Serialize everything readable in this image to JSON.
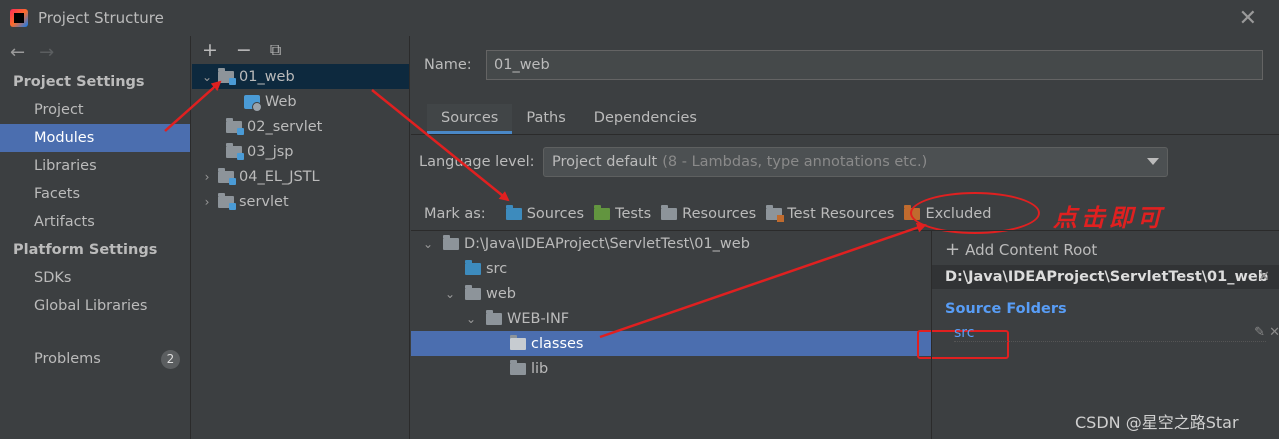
{
  "window": {
    "title": "Project Structure",
    "close_icon": "close-icon"
  },
  "nav": {
    "project_settings": "Project Settings",
    "project_items": [
      "Project",
      "Modules",
      "Libraries",
      "Facets",
      "Artifacts"
    ],
    "platform_settings": "Platform Settings",
    "platform_items": [
      "SDKs",
      "Global Libraries"
    ],
    "problems": "Problems",
    "problems_count": "2",
    "active": "Modules"
  },
  "modules_tree": {
    "tools": {
      "add": "+",
      "remove": "−",
      "copy": "⧉"
    },
    "items": [
      {
        "label": "01_web",
        "expanded": true,
        "selected": true
      },
      {
        "label": "Web"
      },
      {
        "label": "02_servlet"
      },
      {
        "label": "03_jsp"
      },
      {
        "label": "04_EL_JSTL"
      },
      {
        "label": "servlet"
      }
    ]
  },
  "content": {
    "name_label": "Name:",
    "name_value": "01_web",
    "tabs": [
      "Sources",
      "Paths",
      "Dependencies"
    ],
    "active_tab": "Sources",
    "language_label": "Language level:",
    "language_value": "Project default",
    "language_hint": "(8 - Lambdas, type annotations etc.)",
    "mark_as_label": "Mark as:",
    "mark_buttons": [
      "Sources",
      "Tests",
      "Resources",
      "Test Resources",
      "Excluded"
    ],
    "annotation": "点击即可",
    "file_tree": [
      {
        "label": "D:\\Java\\IDEAProject\\ServletTest\\01_web"
      },
      {
        "label": "src"
      },
      {
        "label": "web"
      },
      {
        "label": "WEB-INF"
      },
      {
        "label": "classes",
        "selected": true
      },
      {
        "label": "lib"
      }
    ],
    "right_panel": {
      "add_content_root": "Add Content Root",
      "root_path": "D:\\Java\\IDEAProject\\ServletTest\\01_web",
      "source_folders_label": "Source Folders",
      "source_folder": "src"
    }
  },
  "watermark": "CSDN @星空之路Star",
  "colors": {
    "selection": "#4b6eaf",
    "accent_blue": "#589df6",
    "annotation_red": "#e02020",
    "background": "#3c3f41"
  }
}
